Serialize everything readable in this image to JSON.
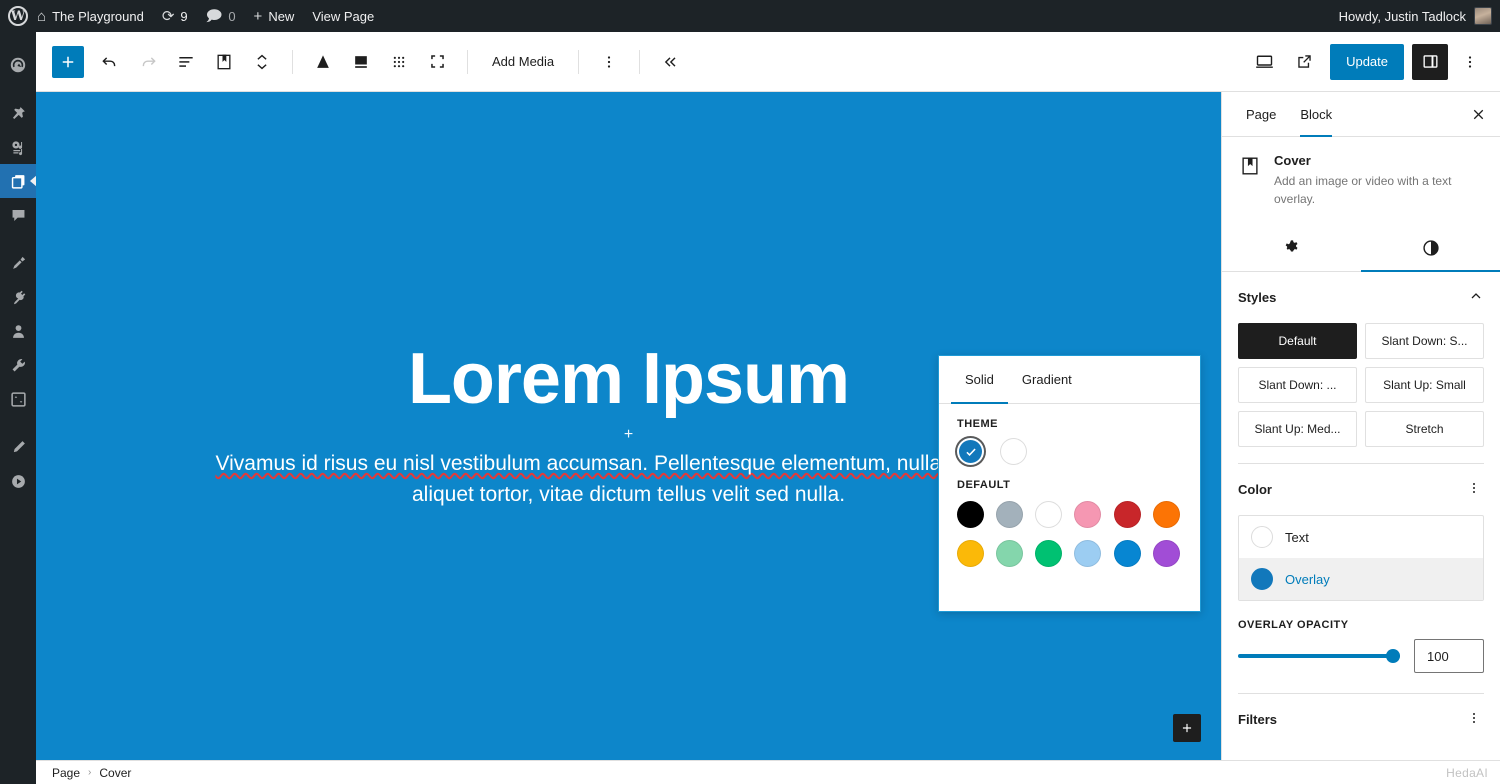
{
  "adminbar": {
    "logo_icon": "wordpress-logo-icon",
    "site_icon": "home-icon",
    "site_name": "The Playground",
    "updates_icon": "updates-icon",
    "updates_count": "9",
    "comments_icon": "comment-bubble-icon",
    "comments_count": "0",
    "new_icon": "plus-icon",
    "new_label": "New",
    "view_page_label": "View Page",
    "howdy": "Howdy, Justin Tadlock",
    "avatar": "user-avatar"
  },
  "adminmenu": {
    "items": [
      {
        "icon": "dashboard-gauge-icon",
        "name": "dashboard",
        "current": false
      },
      {
        "icon": "pin-posts-icon",
        "name": "posts",
        "current": false
      },
      {
        "icon": "media-icon",
        "name": "media",
        "current": false
      },
      {
        "icon": "pages-icon",
        "name": "pages",
        "current": true
      },
      {
        "icon": "comments-bubble-icon",
        "name": "comments",
        "current": false
      },
      {
        "icon": "appearance-brush-icon",
        "name": "appearance",
        "current": false
      },
      {
        "icon": "plugins-plug-icon",
        "name": "plugins",
        "current": false
      },
      {
        "icon": "users-icon",
        "name": "users",
        "current": false
      },
      {
        "icon": "tools-wrench-icon",
        "name": "tools",
        "current": false
      },
      {
        "icon": "settings-sliders-icon",
        "name": "settings",
        "current": false
      },
      {
        "icon": "pencil-icon",
        "name": "edit",
        "current": false
      },
      {
        "icon": "play-circle-icon",
        "name": "play",
        "current": false
      }
    ]
  },
  "toolbar": {
    "add_block_icon": "plus-icon",
    "undo_icon": "undo-arrow-icon",
    "redo_icon": "redo-arrow-icon",
    "list_view_icon": "list-view-icon",
    "block_icon": "cover-block-icon",
    "mover_icon": "up-down-chevrons-icon",
    "align_icon": "align-triangle-icon",
    "position_icon": "block-position-icon",
    "drag_icon": "drag-dots-icon",
    "fullscreen_icon": "fullscreen-brackets-icon",
    "add_media_label": "Add Media",
    "options_icon": "three-dots-vertical-icon",
    "collapse_icon": "double-chevron-left-icon",
    "preview_icon": "desktop-preview-icon",
    "view_icon": "external-link-icon",
    "update_label": "Update",
    "settings_toggle_icon": "settings-sidebar-icon",
    "more_icon": "three-dots-vertical-icon"
  },
  "canvas": {
    "cover": {
      "overlay_color": "#0d86ca",
      "title": "Lorem Ipsum",
      "insert_plus": "+",
      "paragraph_lines": [
        "Vivamus id risus eu nisl vestibulum accumsan. Pellentesque elementum, nulla ac fringilla",
        "aliquet tortor, vitae dictum tellus velit sed nulla."
      ],
      "appender_icon": "plus-icon"
    }
  },
  "breadcrumb": {
    "items": [
      "Page",
      "Cover"
    ],
    "separator": "›",
    "watermark": "HedaAI"
  },
  "settings": {
    "tabs": [
      {
        "label": "Page",
        "active": false
      },
      {
        "label": "Block",
        "active": true
      }
    ],
    "close_icon": "close-x-icon",
    "block_card": {
      "icon": "cover-block-icon",
      "title": "Cover",
      "description": "Add an image or video with a text overlay."
    },
    "icon_tabs": [
      {
        "icon": "gear-icon",
        "name": "settings-tab",
        "active": false
      },
      {
        "icon": "contrast-half-circle-icon",
        "name": "styles-tab",
        "active": true
      }
    ],
    "styles": {
      "title": "Styles",
      "chevron_icon": "chevron-up-icon",
      "options": [
        {
          "label": "Default",
          "active": true
        },
        {
          "label": "Slant Down: S...",
          "active": false
        },
        {
          "label": "Slant Down: ...",
          "active": false
        },
        {
          "label": "Slant Up: Small",
          "active": false
        },
        {
          "label": "Slant Up: Med...",
          "active": false
        },
        {
          "label": "Stretch",
          "active": false
        }
      ]
    },
    "color": {
      "title": "Color",
      "menu_icon": "three-dots-vertical-icon",
      "rows": [
        {
          "label": "Text",
          "swatch": "#ffffff",
          "selected": false
        },
        {
          "label": "Overlay",
          "swatch": "#1278bb",
          "selected": true
        }
      ]
    },
    "overlay_opacity": {
      "label": "Overlay opacity",
      "value": "100",
      "percent": 100,
      "accent": "#007cba"
    },
    "filters": {
      "title": "Filters",
      "menu_icon": "three-dots-vertical-icon"
    }
  },
  "color_popover": {
    "tabs": [
      {
        "label": "Solid",
        "active": true
      },
      {
        "label": "Gradient",
        "active": false
      }
    ],
    "theme_label": "Theme",
    "theme_swatches": [
      {
        "color": "#1278bb",
        "selected": true,
        "check_icon": "check-icon"
      },
      {
        "color": "#ffffff",
        "selected": false
      }
    ],
    "default_label": "Default",
    "default_swatches": [
      "#000000",
      "#a3b1bb",
      "#ffffff",
      "#f597b2",
      "#c8262a",
      "#fc7405",
      "#fbb908",
      "#84d6ac",
      "#00c островов",
      "#9ccdf2",
      "#0786d2",
      "#a14dd6"
    ]
  }
}
